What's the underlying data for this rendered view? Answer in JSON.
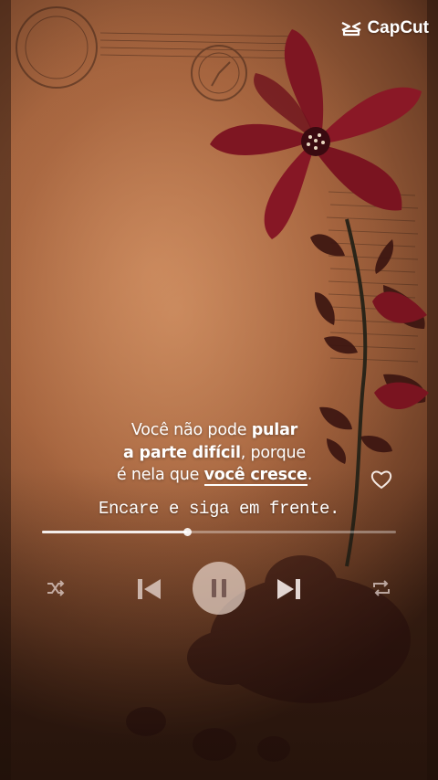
{
  "watermark": {
    "brand": "CapCut",
    "icon": "capcut-logo-icon"
  },
  "quote": {
    "line1_plain": "Você não pode ",
    "line1_bold": "pular",
    "line2_bold": "a parte difícil",
    "line2_plain": ", porque",
    "line3_plain": "é nela que ",
    "line3_bold": "você cresce",
    "line3_end": "."
  },
  "subtitle": "Encare e siga em frente.",
  "player": {
    "progress": 0.41,
    "controls": {
      "shuffle": "shuffle-icon",
      "previous": "skip-previous-icon",
      "play_pause": "pause-icon",
      "next": "skip-next-icon",
      "repeat": "repeat-icon",
      "like": "heart-icon"
    }
  },
  "colors": {
    "flower": "#7a1420",
    "paper": "#b8734a",
    "text": "#ffffff"
  }
}
